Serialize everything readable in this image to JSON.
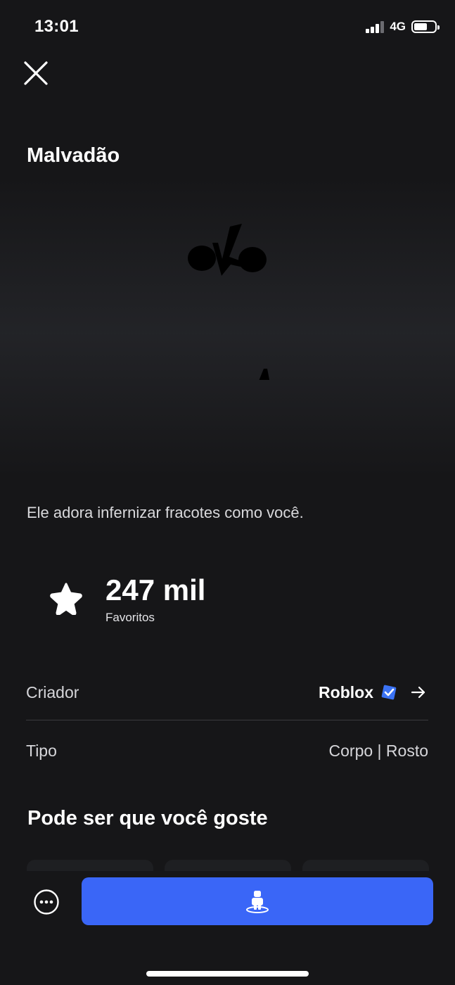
{
  "status_bar": {
    "time": "13:01",
    "network": "4G",
    "signal_level": 3,
    "signal_max": 4,
    "battery_percent": 65
  },
  "item": {
    "title": "Malvadão",
    "description": "Ele adora infernizar fracotes como você."
  },
  "favorites": {
    "count": "247 mil",
    "label": "Favoritos"
  },
  "details": {
    "creator_label": "Criador",
    "creator_name": "Roblox",
    "type_label": "Tipo",
    "type_value": "Corpo | Rosto"
  },
  "recommendations": {
    "title": "Pode ser que você goste"
  },
  "icons": {
    "close": "close-icon",
    "star": "star-icon",
    "verified": "verified-badge-icon",
    "arrow": "arrow-right-icon",
    "more": "more-options-icon",
    "try_on": "avatar-try-on-icon"
  },
  "colors": {
    "background": "#161618",
    "accent": "#3a66f7",
    "verified": "#3b73f5"
  }
}
